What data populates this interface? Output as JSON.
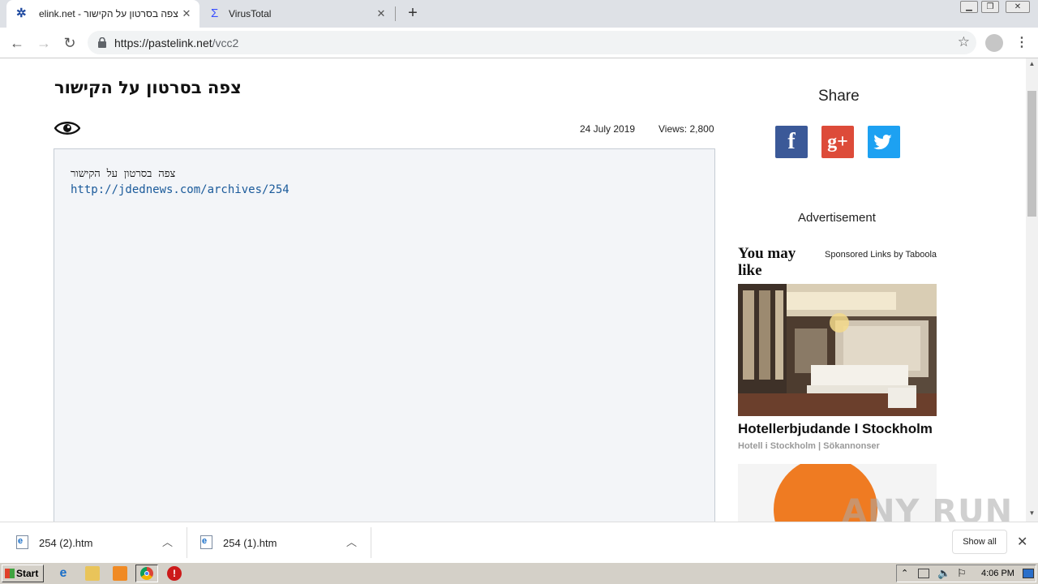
{
  "browser": {
    "tabs": [
      {
        "title": "צפה בסרטון על הקישור - elink.net",
        "active": true
      },
      {
        "title": "VirusTotal",
        "active": false
      }
    ],
    "url_scheme_host": "https://pastelink.net",
    "url_path": "/vcc2"
  },
  "paste": {
    "title": "צפה בסרטון על הקישור",
    "date": "24 July 2019",
    "views": "Views: 2,800",
    "content_line": "צפה בסרטון על הקישור",
    "content_link": "http://jdednews.com/archives/254"
  },
  "sidebar": {
    "share_heading": "Share",
    "share_buttons": [
      {
        "name": "facebook",
        "glyph": "f",
        "color": "#3b5998"
      },
      {
        "name": "google-plus",
        "glyph": "g+",
        "color": "#dd4b39"
      },
      {
        "name": "twitter",
        "glyph": "t",
        "color": "#1da1f2"
      }
    ],
    "advertisement_label": "Advertisement",
    "you_may_like": "You may like",
    "sponsored": "Sponsored Links by Taboola",
    "ad_title": "Hotellerbjudande I Stockholm",
    "ad_source": "Hotell i Stockholm | Sökannonser"
  },
  "downloads": {
    "items": [
      {
        "name": "254 (2).htm"
      },
      {
        "name": "254 (1).htm"
      }
    ],
    "show_all": "Show all"
  },
  "taskbar": {
    "start": "Start",
    "clock": "4:06 PM"
  },
  "watermark": "ANY RUN"
}
